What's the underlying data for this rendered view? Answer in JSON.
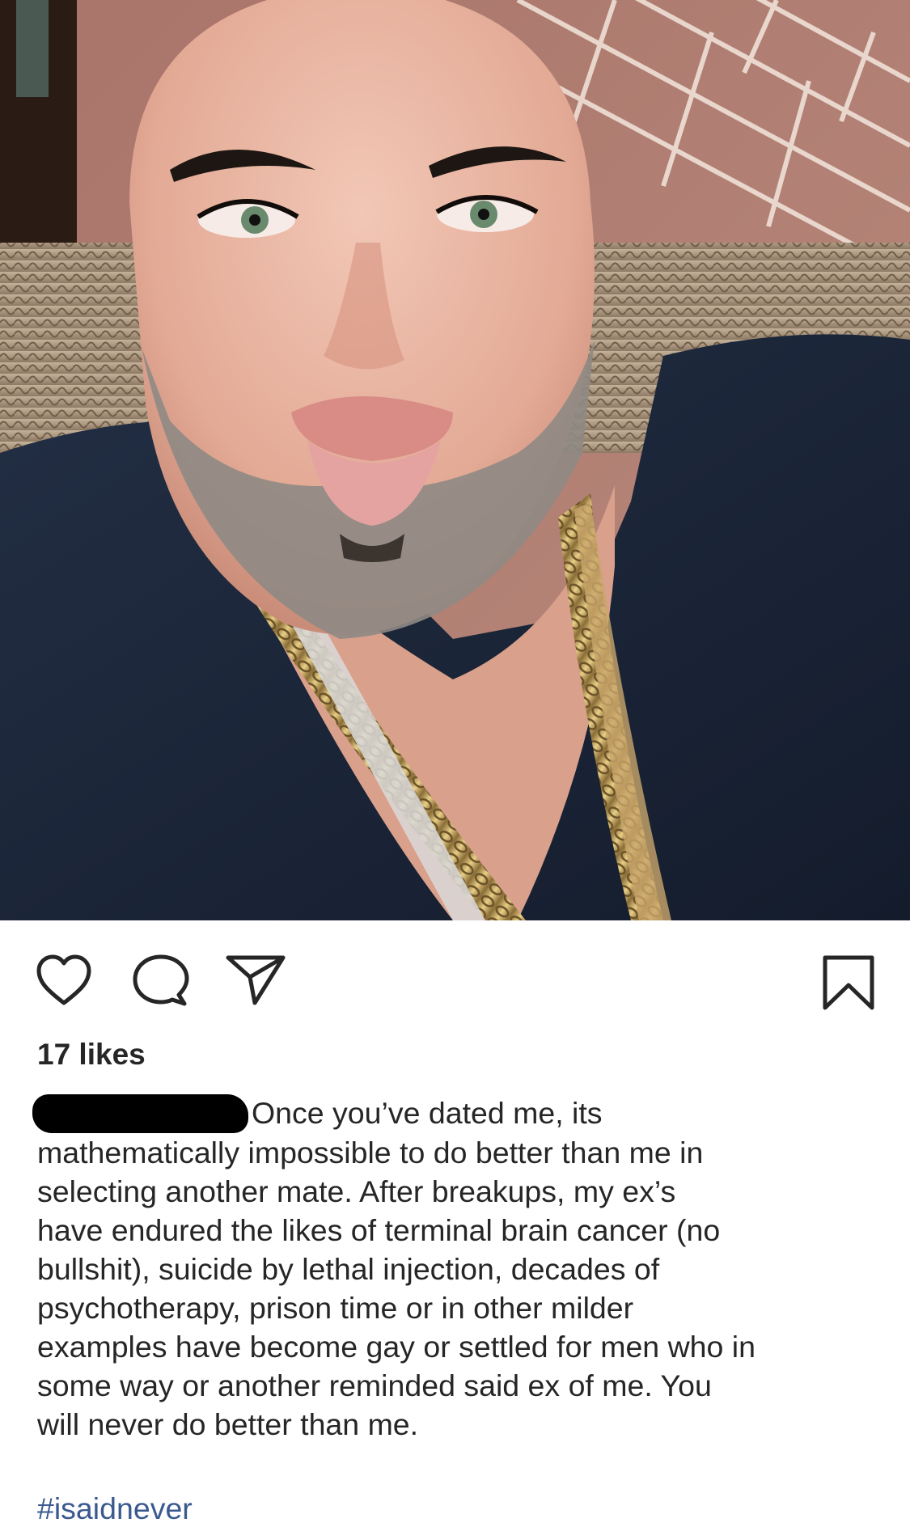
{
  "post": {
    "image": {
      "subject": "selfie of bald man with gray beard wearing navy shirt and gold chain necklaces"
    },
    "actions": {
      "like_icon": "heart-icon",
      "comment_icon": "comment-bubble-icon",
      "share_icon": "paper-plane-icon",
      "save_icon": "bookmark-icon"
    },
    "likes": "17 likes",
    "caption": {
      "username_redacted": true,
      "lines": [
        "Once you’ve dated me, its",
        "mathematically impossible to do better than me in",
        "selecting another mate.  After breakups, my ex’s",
        "have endured the likes of terminal brain cancer (no",
        "bullshit), suicide by lethal injection, decades of",
        "psychotherapy, prison time or in other milder",
        "examples have become gay or settled for men who in",
        "some way or another reminded said ex of me.  You",
        "will never do better than me."
      ]
    },
    "hashtag": "#isaidnever"
  },
  "colors": {
    "text": "#262626",
    "hashtag": "#3a5a8f",
    "background": "#ffffff"
  }
}
